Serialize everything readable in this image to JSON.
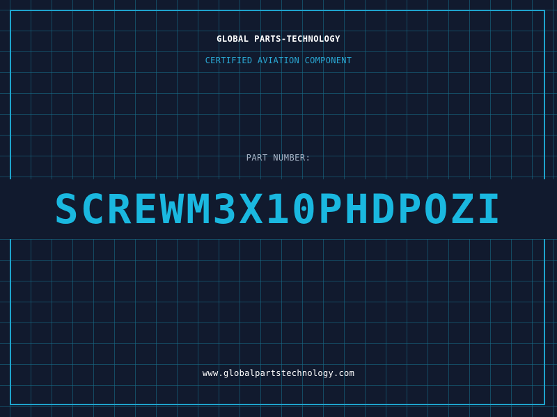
{
  "card": {
    "company_name": "GLOBAL PARTS-TECHNOLOGY",
    "subtitle": "CERTIFIED AVIATION COMPONENT",
    "part_number_label": "PART NUMBER:",
    "part_number": "SCREWM3X10PHDPOZI",
    "website": "www.globalpartstechnology.com"
  },
  "colors": {
    "background": "#111a2e",
    "grid": "#16708c",
    "accent": "#1ab8e0",
    "text": "#ffffff"
  }
}
